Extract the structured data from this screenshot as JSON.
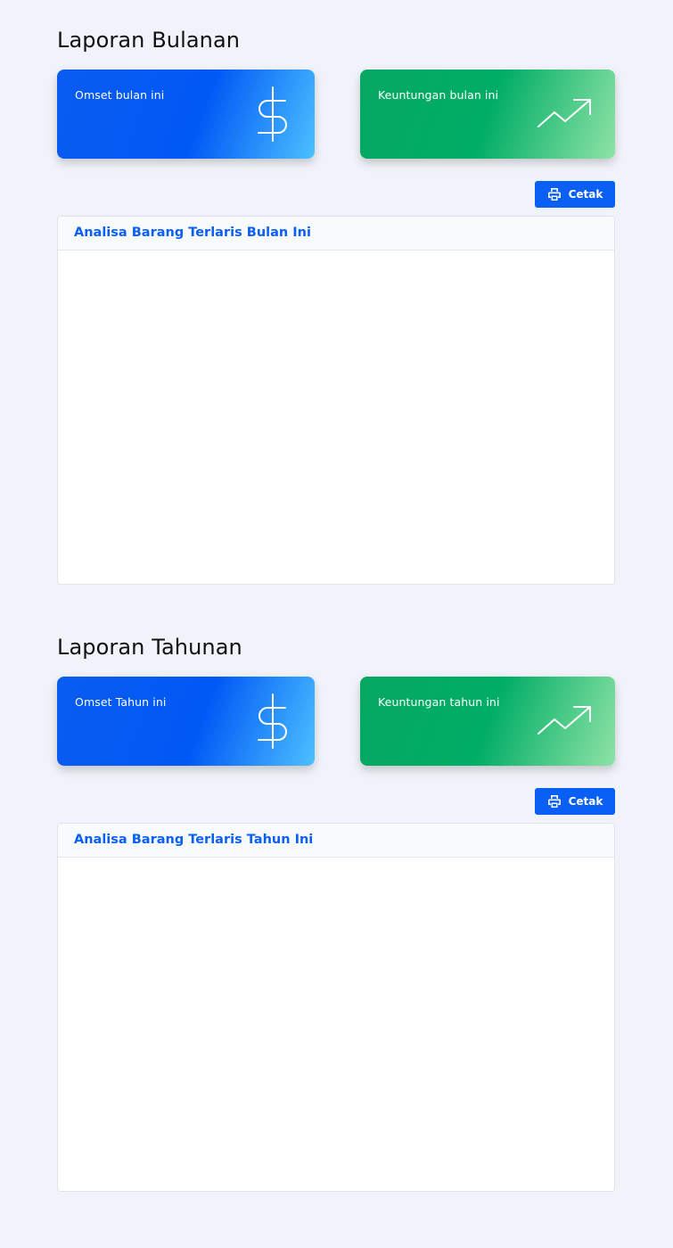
{
  "monthly": {
    "title": "Laporan Bulanan",
    "revenue_card": {
      "label": "Omset bulan ini",
      "icon": "dollar-icon"
    },
    "profit_card": {
      "label": "Keuntungan bulan ini",
      "icon": "trending-up-icon"
    },
    "print_button": {
      "label": "Cetak",
      "icon": "printer-icon"
    },
    "analysis_panel": {
      "title": "Analisa Barang Terlaris Bulan Ini"
    }
  },
  "yearly": {
    "title": "Laporan Tahunan",
    "revenue_card": {
      "label": "Omset Tahun ini",
      "icon": "dollar-icon"
    },
    "profit_card": {
      "label": "Keuntungan tahun ini",
      "icon": "trending-up-icon"
    },
    "print_button": {
      "label": "Cetak",
      "icon": "printer-icon"
    },
    "analysis_panel": {
      "title": "Analisa Barang Terlaris Tahun Ini"
    }
  },
  "colors": {
    "page_background": "#f0f3f9",
    "primary_blue": "#0a5ff5",
    "card_green": "#00ad66"
  }
}
